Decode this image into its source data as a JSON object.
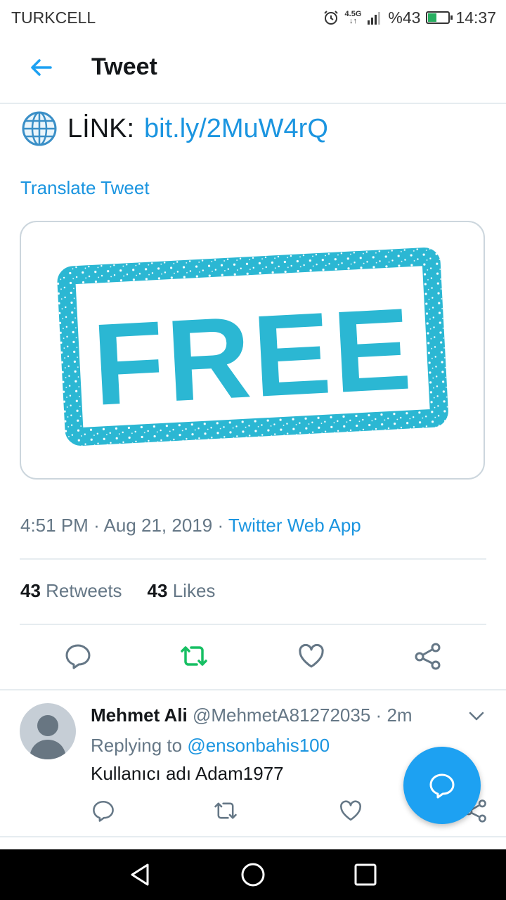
{
  "status_bar": {
    "carrier": "TURKCELL",
    "network_top": "4.5G",
    "network_bottom": "↓↑",
    "battery": "%43",
    "battery_level": 0.43,
    "time": "14:37"
  },
  "header": {
    "title": "Tweet"
  },
  "tweet": {
    "link_label": "LİNK:",
    "link_url": "bit.ly/2MuW4rQ",
    "translate": "Translate Tweet",
    "media_text": "FREE",
    "time": "4:51 PM",
    "sep1": "·",
    "date": "Aug 21, 2019",
    "sep2": "·",
    "source": "Twitter Web App",
    "retweets_count": "43",
    "retweets_label": "Retweets",
    "likes_count": "43",
    "likes_label": "Likes"
  },
  "reply": {
    "name": "Mehmet Ali",
    "handle": "@MehmetA81272035",
    "sep": "·",
    "age": "2m",
    "replying_prefix": "Replying to",
    "replying_to": "@ensonbahis100",
    "text": "Kullanıcı adı Adam1977"
  },
  "colors": {
    "accent": "#1da1f2",
    "link": "#1b95e0",
    "retweet_active": "#17bf63",
    "muted": "#657786",
    "stamp": "#2bb7d3"
  },
  "icons": {
    "tweet_actions": [
      "reply-icon",
      "retweet-icon",
      "like-icon",
      "share-icon"
    ],
    "reply_actions": [
      "reply-icon",
      "retweet-icon",
      "like-icon",
      "share-icon"
    ],
    "nav": [
      "back-triangle-icon",
      "home-circle-icon",
      "recents-square-icon"
    ]
  }
}
